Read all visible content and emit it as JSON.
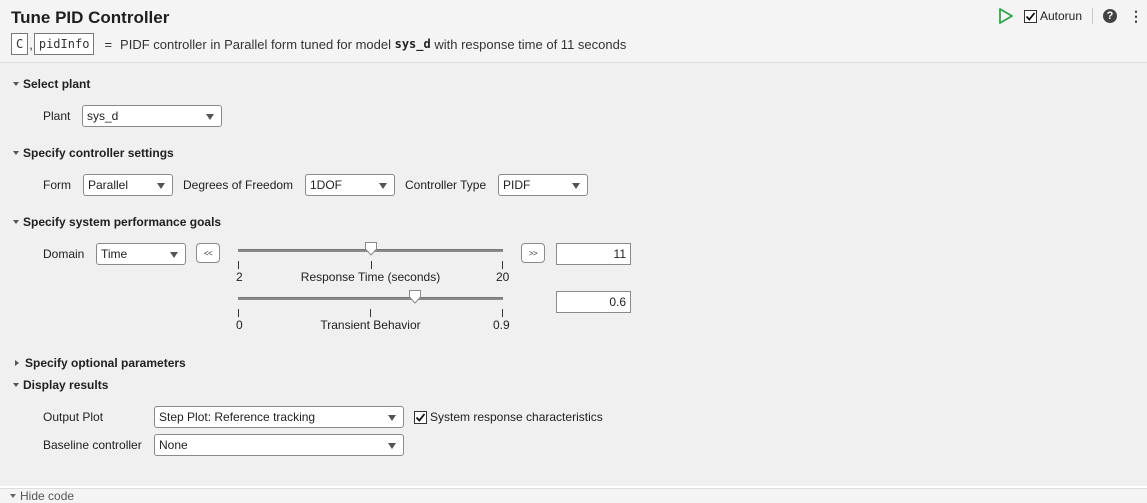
{
  "header": {
    "title": "Tune PID Controller",
    "outputs": [
      "C",
      "pidInfo"
    ],
    "comma": ",",
    "equals": "=",
    "summary_prefix": "PIDF controller in Parallel form tuned for model",
    "summary_model": "sys_d",
    "summary_suffix": "with response time of 11 seconds",
    "toolbar": {
      "run_icon": "play-icon",
      "autorun_label": "Autorun",
      "autorun_checked": true,
      "help_icon": "help-icon",
      "help_glyph": "?",
      "more_icon": "more-options-icon",
      "more_glyph": "⋮"
    }
  },
  "sections": {
    "select_plant": {
      "title": "Select plant",
      "expanded": true,
      "plant_label": "Plant",
      "plant_value": "sys_d"
    },
    "controller_settings": {
      "title": "Specify controller settings",
      "expanded": true,
      "form_label": "Form",
      "form_value": "Parallel",
      "dof_label": "Degrees of Freedom",
      "dof_value": "1DOF",
      "type_label": "Controller Type",
      "type_value": "PIDF"
    },
    "performance_goals": {
      "title": "Specify system performance goals",
      "expanded": true,
      "domain_label": "Domain",
      "domain_value": "Time",
      "decrease_button": "<<",
      "increase_button": ">>",
      "response_time": {
        "label": "Response Time (seconds)",
        "min_label": "2",
        "max_label": "20",
        "min": 2,
        "max": 20,
        "value": 11,
        "value_text": "11"
      },
      "transient": {
        "label": "Transient Behavior",
        "min_label": "0",
        "max_label": "0.9",
        "min": 0,
        "max": 0.9,
        "value": 0.6,
        "value_text": "0.6"
      }
    },
    "optional_params": {
      "title": "Specify optional parameters",
      "expanded": false
    },
    "display_results": {
      "title": "Display results",
      "expanded": true,
      "output_plot_label": "Output Plot",
      "output_plot_value": "Step Plot: Reference tracking",
      "characteristics_label": "System response characteristics",
      "characteristics_checked": true,
      "baseline_label": "Baseline controller",
      "baseline_value": "None"
    }
  },
  "footer": {
    "hide_code_label": "Hide code"
  },
  "colors": {
    "run_green": "#2ea44f",
    "header_bg": "#f4f4f4",
    "body_bg": "#f0f0f0"
  }
}
